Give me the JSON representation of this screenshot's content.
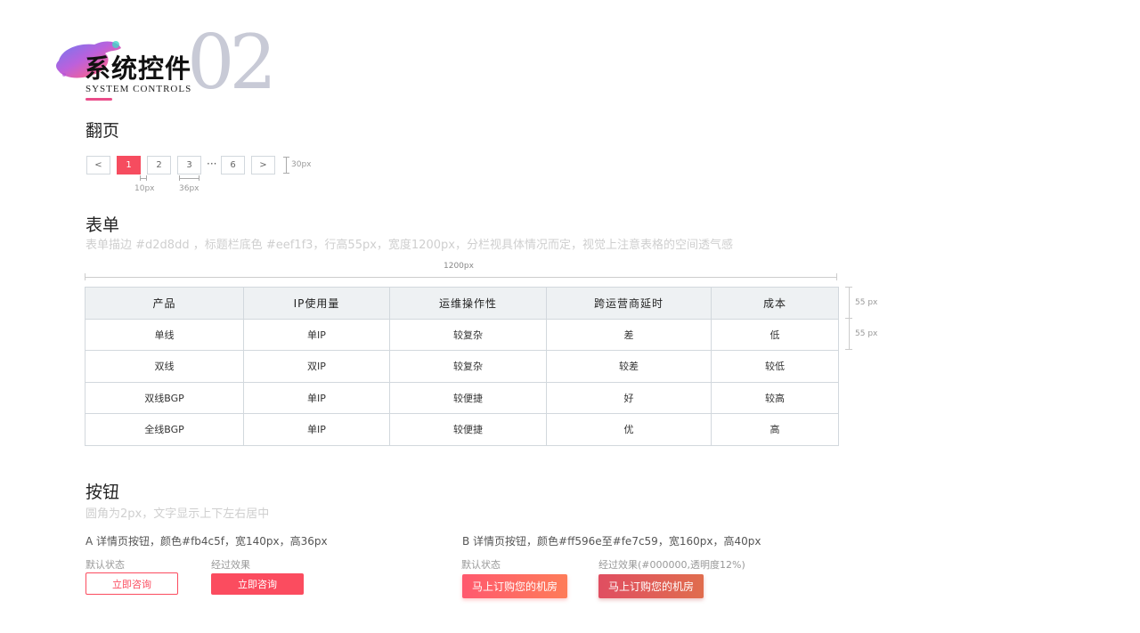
{
  "header": {
    "title": "系统控件",
    "subtitle": "SYSTEM CONTROLS",
    "number": "02"
  },
  "pagination": {
    "title": "翻页",
    "prev": "<",
    "next": ">",
    "pages": [
      "1",
      "2",
      "3",
      "6"
    ],
    "ellipsis": "···",
    "active_page": "1",
    "active_color": "#f64c5f",
    "height_label": "30px",
    "gap_label": "10px",
    "width_label": "36px"
  },
  "form": {
    "title": "表单",
    "description": "表单描边 #d2d8dd ，标题栏底色 #eef1f3，行高55px，宽度1200px，分栏视具体情况而定，视觉上注意表格的空间透气感",
    "width_label": "1200px",
    "header_height_label": "55 px",
    "row_height_label": "55 px",
    "border_color": "#d2d8dd",
    "header_bg": "#eef1f3",
    "columns": [
      "产品",
      "IP使用量",
      "运维操作性",
      "跨运营商延时",
      "成本"
    ],
    "rows": [
      [
        "单线",
        "单IP",
        "较复杂",
        "差",
        "低"
      ],
      [
        "双线",
        "双IP",
        "较复杂",
        "较差",
        "较低"
      ],
      [
        "双线BGP",
        "单IP",
        "较便捷",
        "好",
        "较高"
      ],
      [
        "全线BGP",
        "单IP",
        "较便捷",
        "优",
        "高"
      ]
    ]
  },
  "buttons": {
    "title": "按钮",
    "description": "圆角为2px，文字显示上下左右居中",
    "a": {
      "caption": "A 详情页按钮，颜色#fb4c5f，宽140px，高36px",
      "default_state": "默认状态",
      "hover_state": "经过效果",
      "label": "立即咨询",
      "color": "#fb4c5f"
    },
    "b": {
      "caption": "B 详情页按钮，颜色#ff596e至#fe7c59，宽160px，高40px",
      "default_state": "默认状态",
      "hover_state": "经过效果(#000000,透明度12%)",
      "label": "马上订购您的机房",
      "color_start": "#ff596e",
      "color_end": "#fe7c59"
    }
  }
}
